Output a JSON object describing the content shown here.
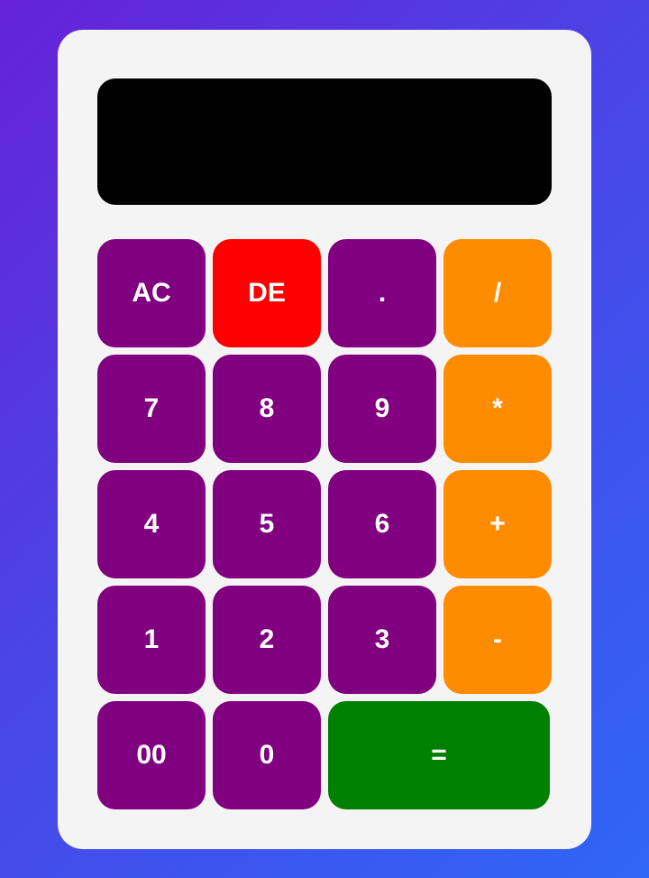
{
  "display": {
    "value": ""
  },
  "keys": {
    "ac": "AC",
    "de": "DE",
    "dot": ".",
    "divide": "/",
    "seven": "7",
    "eight": "8",
    "nine": "9",
    "multiply": "*",
    "four": "4",
    "five": "5",
    "six": "6",
    "plus": "+",
    "one": "1",
    "two": "2",
    "three": "3",
    "minus": "-",
    "double_zero": "00",
    "zero": "0",
    "equals": "="
  },
  "colors": {
    "number_key": "#800080",
    "operator_key": "#ff8c00",
    "delete_key": "#ff0000",
    "equals_key": "#008000",
    "display_bg": "#000000",
    "panel_bg": "#f4f4f4"
  }
}
